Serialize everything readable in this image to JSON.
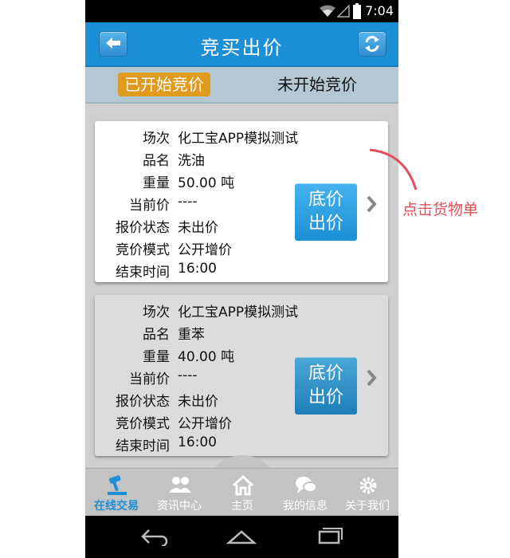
{
  "status_bar": {
    "time": "7:04"
  },
  "header": {
    "title": "竞买出价",
    "back_icon": "back-arrow-icon",
    "refresh_icon": "refresh-icon"
  },
  "tabs": [
    {
      "label": "已开始竞价",
      "active": true
    },
    {
      "label": "未开始竞价",
      "active": false
    }
  ],
  "labels": {
    "session": "场次",
    "product": "品名",
    "weight": "重量",
    "current_price": "当前价",
    "bid_status": "报价状态",
    "bid_mode": "竞价模式",
    "end_time": "结束时间"
  },
  "cards": [
    {
      "session": "化工宝APP模拟测试",
      "product": "洗油",
      "weight": "50.00 吨",
      "current_price": "----",
      "bid_status": "未出价",
      "bid_mode": "公开增价",
      "end_time": "16:00",
      "button_line1": "底价",
      "button_line2": "出价"
    },
    {
      "session": "化工宝APP模拟测试",
      "product": "重苯",
      "weight": "40.00 吨",
      "current_price": "----",
      "bid_status": "未出价",
      "bid_mode": "公开增价",
      "end_time": "16:00",
      "button_line1": "底价",
      "button_line2": "出价"
    }
  ],
  "bottom_nav": [
    {
      "label": "在线交易",
      "icon": "gavel-icon",
      "active": true
    },
    {
      "label": "资讯中心",
      "icon": "users-icon",
      "active": false
    },
    {
      "label": "主页",
      "icon": "home-icon",
      "active": false
    },
    {
      "label": "我的信息",
      "icon": "chat-bubbles-icon",
      "active": false
    },
    {
      "label": "关于我们",
      "icon": "gear-icon",
      "active": false
    }
  ],
  "annotation": {
    "text": "点击货物单",
    "color": "#e0505a"
  },
  "colors": {
    "primary": "#1d8fd6",
    "tab_active": "#e09a1d"
  }
}
